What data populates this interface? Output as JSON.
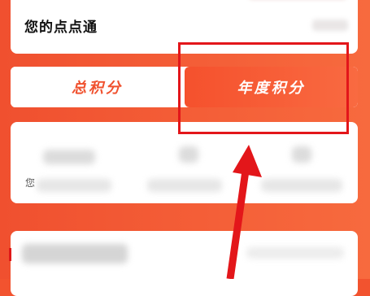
{
  "header": {
    "title": "您的点点通"
  },
  "tabs": [
    {
      "label": "总积分",
      "active": false
    },
    {
      "label": "年度积分",
      "active": true
    }
  ],
  "stats": {
    "side_label": "您"
  },
  "colors": {
    "accent": "#f2532f",
    "active_tab_gradient_start": "#f5512d",
    "active_tab_gradient_end": "#f96a41",
    "annotation": "#e3161a"
  },
  "annotation": {
    "type": "highlight-box-with-arrow",
    "target": "tabs.1"
  }
}
